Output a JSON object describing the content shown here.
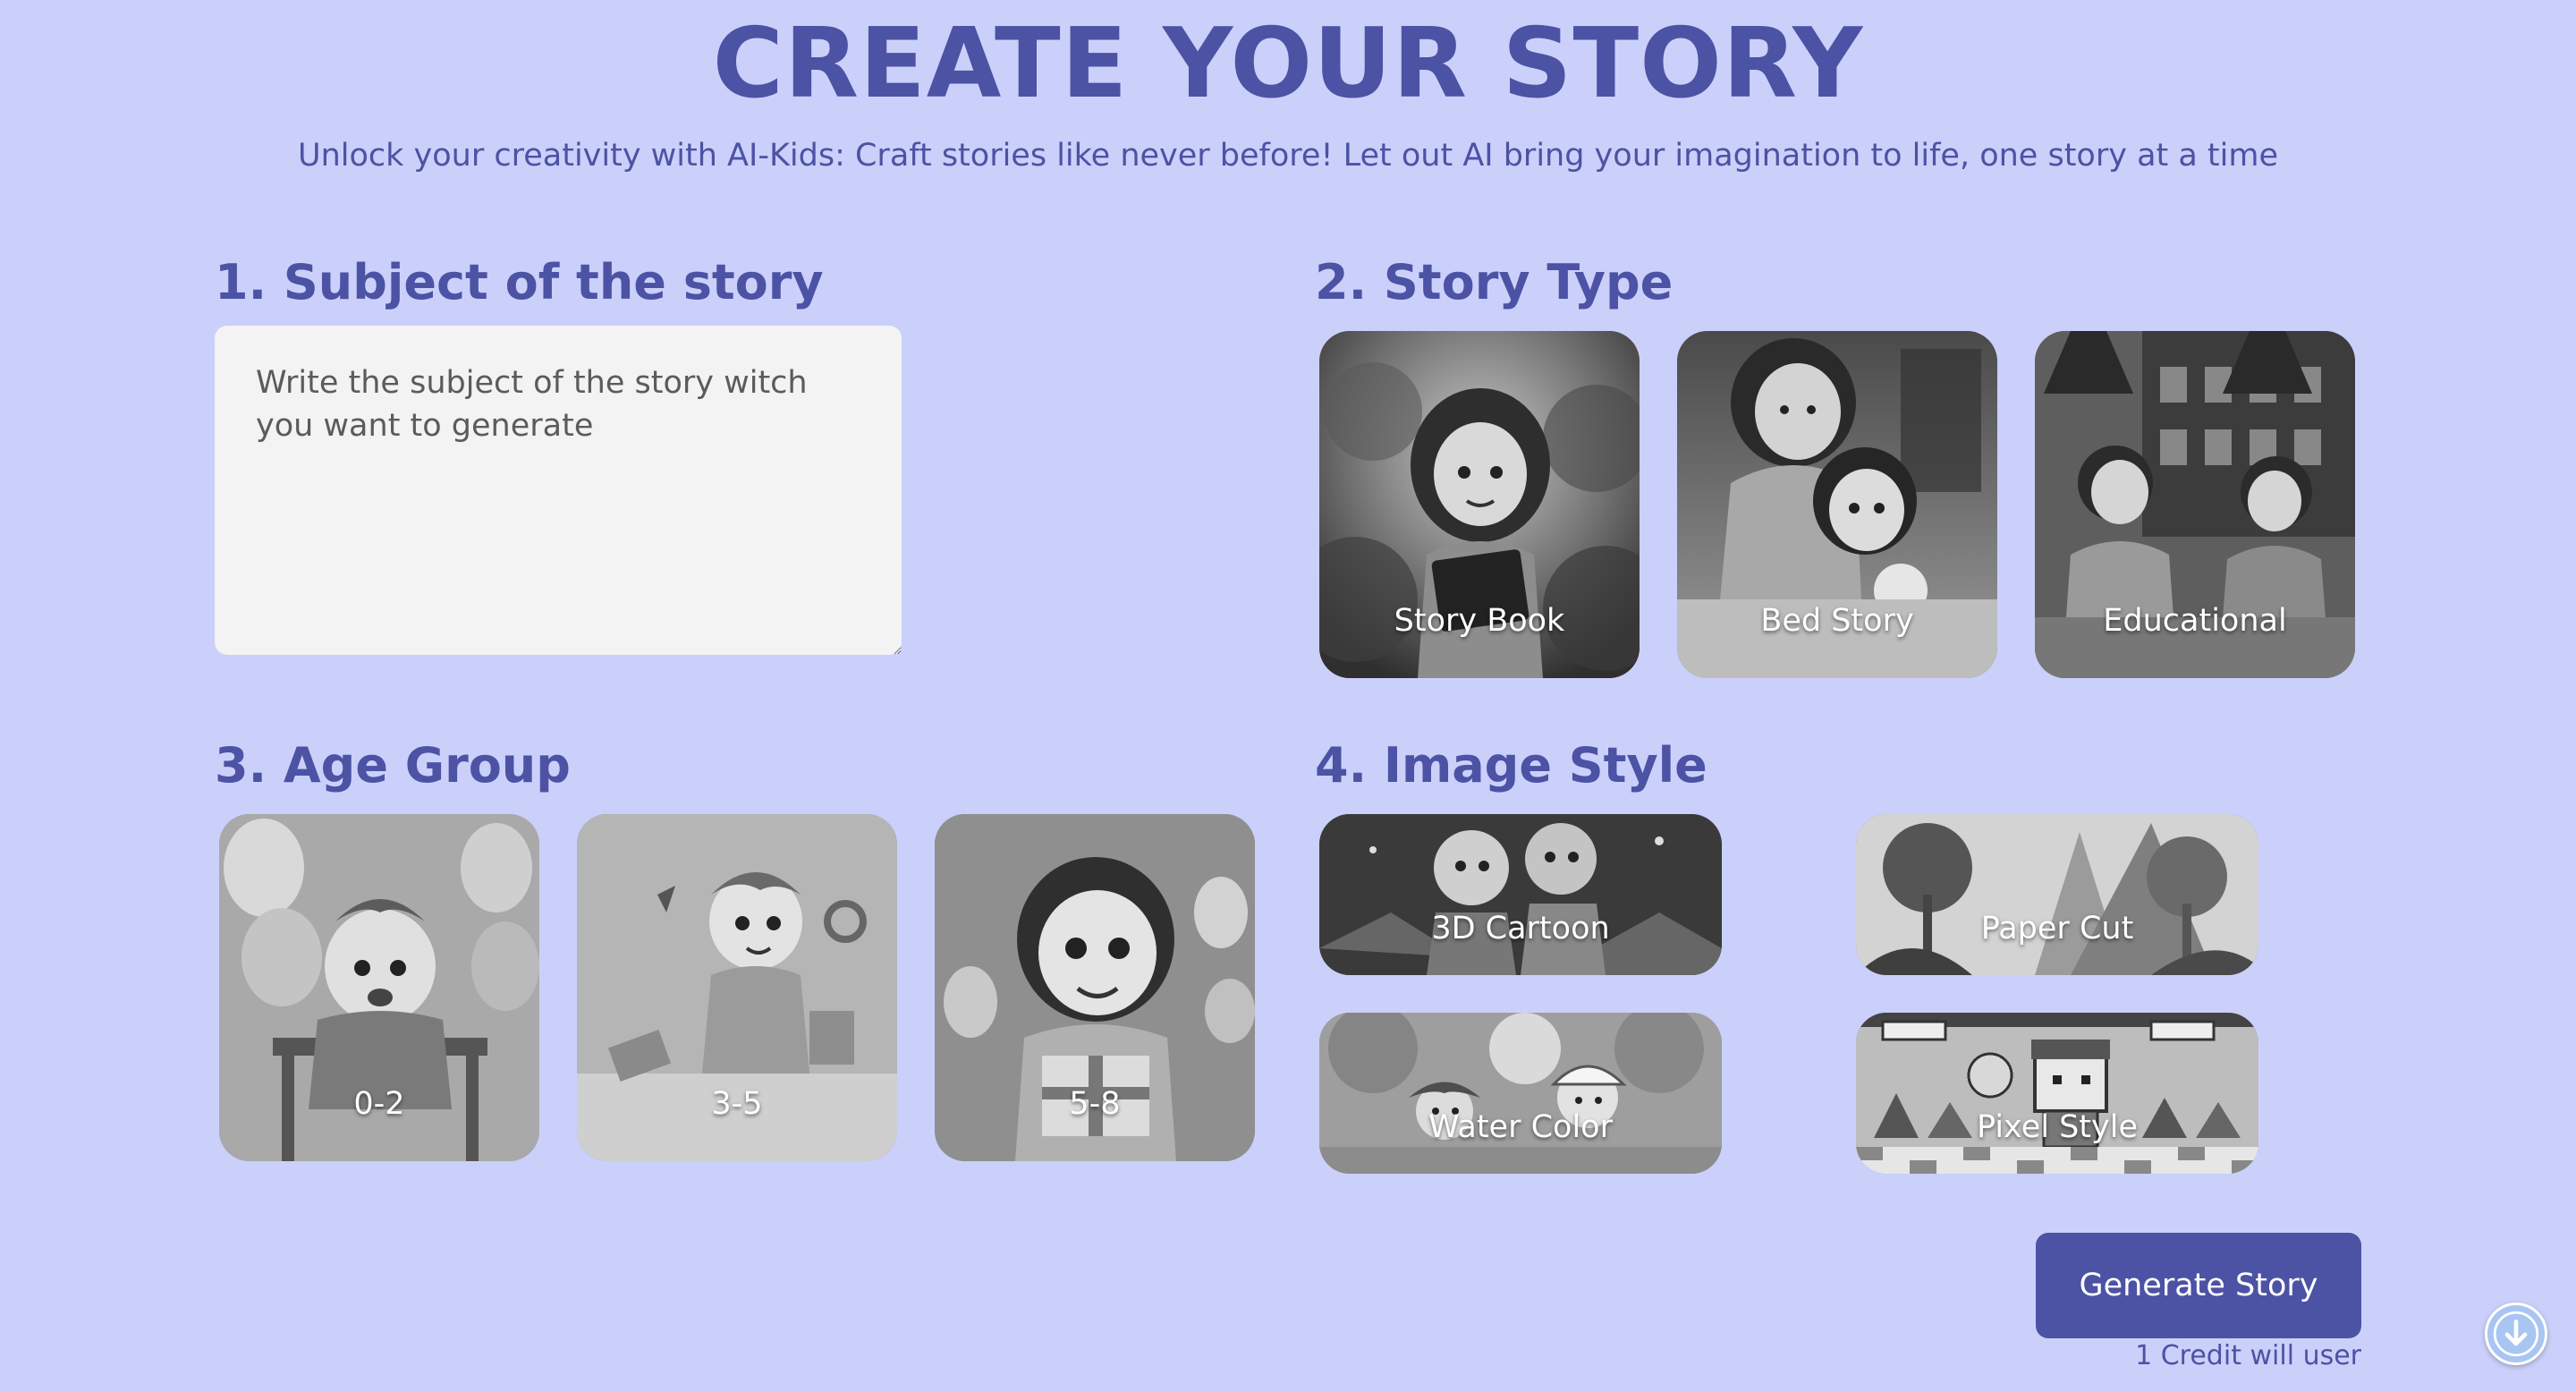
{
  "header": {
    "title": "CREATE YOUR STORY",
    "subtitle": "Unlock your creativity with AI-Kids: Craft stories like never before! Let out AI bring your imagination to life, one story at a time"
  },
  "subject": {
    "heading": "1. Subject of the story",
    "placeholder": "Write the subject of the story witch you want to generate",
    "value": ""
  },
  "story_type": {
    "heading": "2. Story Type",
    "options": [
      {
        "label": "Story Book"
      },
      {
        "label": "Bed Story"
      },
      {
        "label": "Educational"
      }
    ]
  },
  "age_group": {
    "heading": "3. Age Group",
    "options": [
      {
        "label": "0-2"
      },
      {
        "label": "3-5"
      },
      {
        "label": "5-8"
      }
    ]
  },
  "image_style": {
    "heading": "4. Image Style",
    "options": [
      {
        "label": "3D Cartoon"
      },
      {
        "label": "Paper Cut"
      },
      {
        "label": "Water Color"
      },
      {
        "label": "Pixel Style"
      }
    ]
  },
  "actions": {
    "generate_label": "Generate Story",
    "credit_note": "1 Credit will user"
  },
  "icons": {
    "scroll": "arrow-down-circle-icon"
  },
  "colors": {
    "background": "#cbd0fa",
    "accent": "#4c52a4",
    "input_bg": "#f3f3f3"
  }
}
